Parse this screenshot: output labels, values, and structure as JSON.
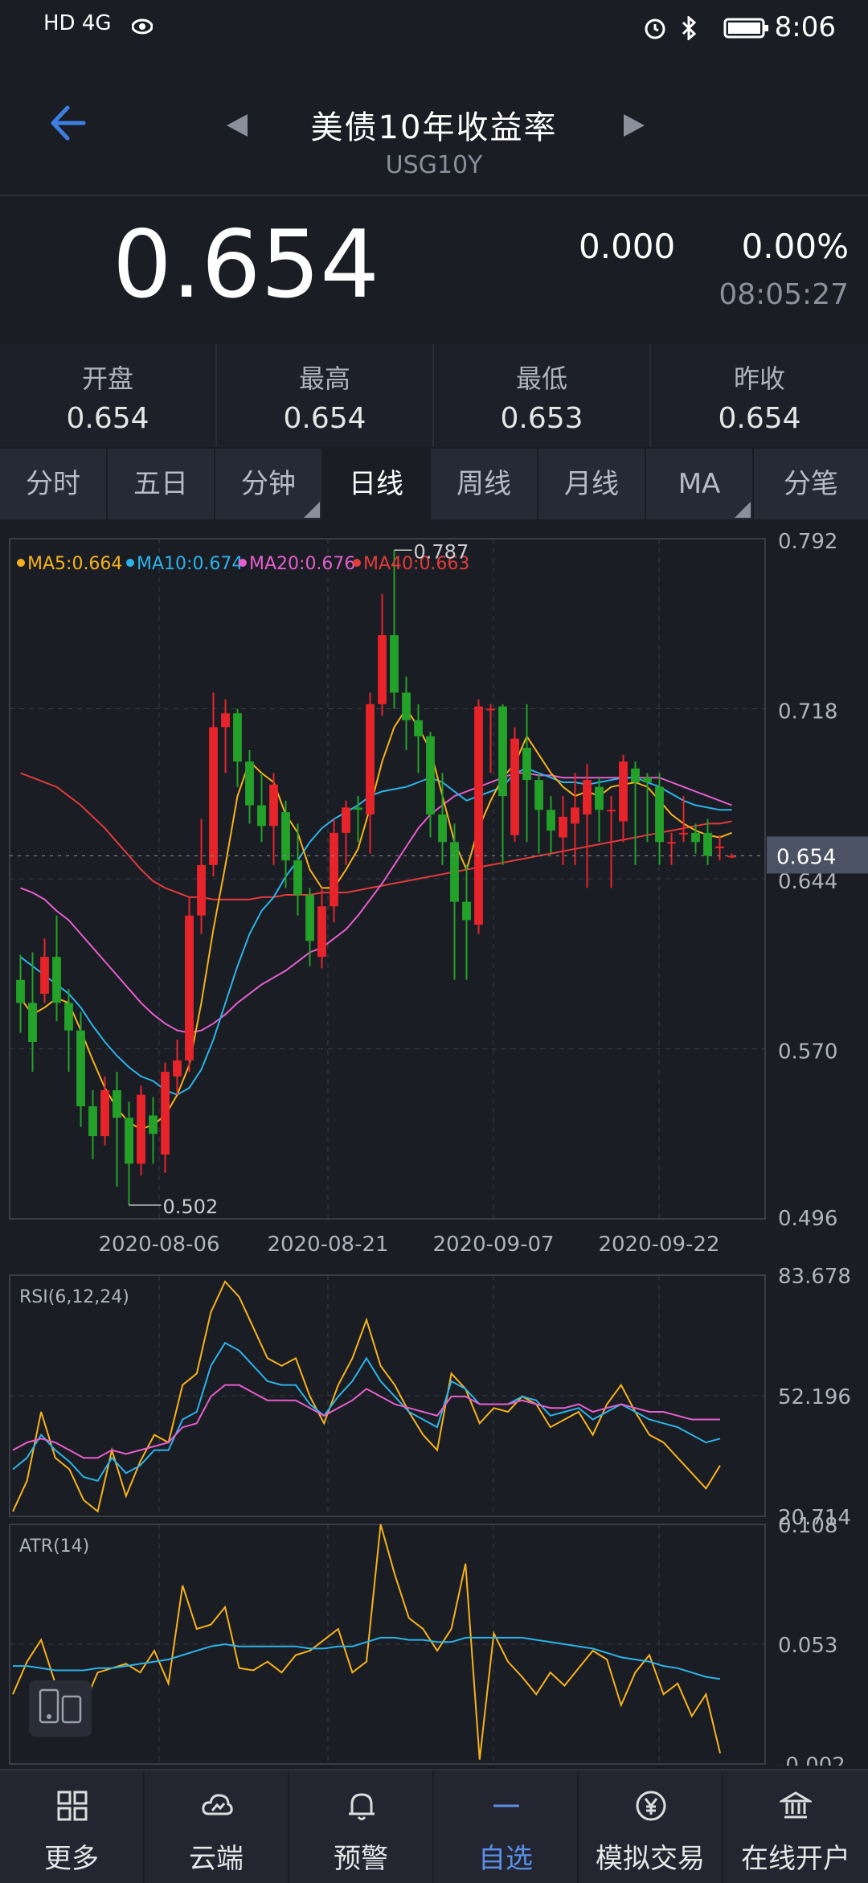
{
  "statusbar": {
    "left": "HD 4G",
    "time": "8:06"
  },
  "header": {
    "title": "美债10年收益率",
    "code": "USG10Y"
  },
  "quote": {
    "price": "0.654",
    "change": "0.000",
    "percent": "0.00%",
    "time": "08:05:27"
  },
  "stats": [
    {
      "label": "开盘",
      "value": "0.654"
    },
    {
      "label": "最高",
      "value": "0.654"
    },
    {
      "label": "最低",
      "value": "0.653"
    },
    {
      "label": "昨收",
      "value": "0.654"
    }
  ],
  "tabs": [
    "分时",
    "五日",
    "分钟",
    "日线",
    "周线",
    "月线",
    "MA",
    "分笔"
  ],
  "active_tab": "日线",
  "colors": {
    "up": "#e8242b",
    "down": "#23a129",
    "ma5": "#f6b21c",
    "ma10": "#2bb3e8",
    "ma20": "#e45fcd",
    "ma40": "#e23b3b",
    "accent": "#5b8fe6"
  },
  "chart_data": [
    {
      "type": "candlestick",
      "legend": [
        {
          "name": "MA5",
          "value": "0.664"
        },
        {
          "name": "MA10",
          "value": "0.674"
        },
        {
          "name": "MA20",
          "value": "0.676"
        },
        {
          "name": "MA40",
          "value": "0.663"
        }
      ],
      "y_ticks": [
        "0.792",
        "0.718",
        "0.644",
        "0.570",
        "0.496"
      ],
      "ylim": [
        0.496,
        0.792
      ],
      "x_ticks": [
        "2020-08-06",
        "2020-08-21",
        "2020-09-07",
        "2020-09-22"
      ],
      "current_label": "0.654",
      "current_value": 0.654,
      "max_label": "0.787",
      "min_label": "0.502",
      "candles": [
        [
          0.6,
          0.59,
          0.611,
          0.577
        ],
        [
          0.59,
          0.573,
          0.612,
          0.56
        ],
        [
          0.594,
          0.61,
          0.618,
          0.59
        ],
        [
          0.61,
          0.59,
          0.628,
          0.582
        ],
        [
          0.59,
          0.578,
          0.596,
          0.56
        ],
        [
          0.578,
          0.545,
          0.586,
          0.536
        ],
        [
          0.545,
          0.532,
          0.552,
          0.522
        ],
        [
          0.532,
          0.552,
          0.558,
          0.528
        ],
        [
          0.552,
          0.54,
          0.56,
          0.51
        ],
        [
          0.54,
          0.52,
          0.547,
          0.502
        ],
        [
          0.52,
          0.55,
          0.554,
          0.515
        ],
        [
          0.541,
          0.533,
          0.549,
          0.52
        ],
        [
          0.524,
          0.56,
          0.564,
          0.516
        ],
        [
          0.558,
          0.565,
          0.574,
          0.55
        ],
        [
          0.565,
          0.628,
          0.636,
          0.56
        ],
        [
          0.628,
          0.65,
          0.67,
          0.62
        ],
        [
          0.65,
          0.71,
          0.725,
          0.645
        ],
        [
          0.71,
          0.716,
          0.722,
          0.69
        ],
        [
          0.716,
          0.695,
          0.718,
          0.684
        ],
        [
          0.695,
          0.676,
          0.7,
          0.668
        ],
        [
          0.676,
          0.667,
          0.69,
          0.66
        ],
        [
          0.667,
          0.685,
          0.69,
          0.65
        ],
        [
          0.673,
          0.652,
          0.678,
          0.64
        ],
        [
          0.652,
          0.637,
          0.668,
          0.628
        ],
        [
          0.637,
          0.617,
          0.64,
          0.606
        ],
        [
          0.61,
          0.632,
          0.64,
          0.605
        ],
        [
          0.632,
          0.664,
          0.67,
          0.625
        ],
        [
          0.664,
          0.675,
          0.678,
          0.65
        ],
        [
          0.675,
          0.674,
          0.68,
          0.66
        ],
        [
          0.672,
          0.72,
          0.725,
          0.655
        ],
        [
          0.72,
          0.75,
          0.768,
          0.715
        ],
        [
          0.75,
          0.725,
          0.787,
          0.718
        ],
        [
          0.725,
          0.713,
          0.732,
          0.7
        ],
        [
          0.713,
          0.706,
          0.72,
          0.69
        ],
        [
          0.706,
          0.672,
          0.708,
          0.662
        ],
        [
          0.672,
          0.66,
          0.69,
          0.65
        ],
        [
          0.66,
          0.634,
          0.668,
          0.6
        ],
        [
          0.634,
          0.626,
          0.65,
          0.6
        ],
        [
          0.624,
          0.719,
          0.722,
          0.62
        ],
        [
          0.718,
          0.718,
          0.72,
          0.69
        ],
        [
          0.719,
          0.68,
          0.72,
          0.65
        ],
        [
          0.663,
          0.705,
          0.71,
          0.66
        ],
        [
          0.701,
          0.687,
          0.72,
          0.66
        ],
        [
          0.687,
          0.674,
          0.69,
          0.655
        ],
        [
          0.674,
          0.665,
          0.68,
          0.655
        ],
        [
          0.662,
          0.671,
          0.68,
          0.65
        ],
        [
          0.668,
          0.675,
          0.69,
          0.65
        ],
        [
          0.672,
          0.687,
          0.694,
          0.64
        ],
        [
          0.684,
          0.674,
          0.688,
          0.66
        ],
        [
          0.674,
          0.674,
          0.68,
          0.64
        ],
        [
          0.669,
          0.695,
          0.698,
          0.66
        ],
        [
          0.692,
          0.686,
          0.695,
          0.65
        ],
        [
          0.688,
          0.686,
          0.69,
          0.66
        ],
        [
          0.684,
          0.66,
          0.69,
          0.65
        ],
        [
          0.66,
          0.66,
          0.664,
          0.65
        ],
        [
          0.664,
          0.664,
          0.68,
          0.66
        ],
        [
          0.664,
          0.66,
          0.668,
          0.655
        ],
        [
          0.664,
          0.654,
          0.67,
          0.65
        ],
        [
          0.658,
          0.658,
          0.663,
          0.652
        ],
        [
          0.654,
          0.654,
          0.655,
          0.653
        ]
      ],
      "ma5": [
        0.592,
        0.585,
        0.588,
        0.592,
        0.59,
        0.578,
        0.565,
        0.553,
        0.544,
        0.538,
        0.535,
        0.537,
        0.541,
        0.55,
        0.563,
        0.59,
        0.622,
        0.65,
        0.68,
        0.695,
        0.69,
        0.686,
        0.672,
        0.664,
        0.648,
        0.64,
        0.64,
        0.648,
        0.657,
        0.675,
        0.695,
        0.71,
        0.718,
        0.71,
        0.7,
        0.68,
        0.66,
        0.648,
        0.666,
        0.678,
        0.688,
        0.694,
        0.706,
        0.698,
        0.69,
        0.684,
        0.68,
        0.682,
        0.68,
        0.684,
        0.685,
        0.686,
        0.684,
        0.678,
        0.672,
        0.668,
        0.665,
        0.663,
        0.662,
        0.664
      ],
      "ma10": [
        0.61,
        0.606,
        0.602,
        0.598,
        0.594,
        0.588,
        0.58,
        0.573,
        0.567,
        0.562,
        0.558,
        0.556,
        0.552,
        0.55,
        0.553,
        0.561,
        0.574,
        0.59,
        0.606,
        0.62,
        0.63,
        0.636,
        0.645,
        0.652,
        0.66,
        0.666,
        0.67,
        0.673,
        0.676,
        0.68,
        0.682,
        0.683,
        0.684,
        0.686,
        0.688,
        0.686,
        0.682,
        0.678,
        0.68,
        0.682,
        0.684,
        0.69,
        0.692,
        0.69,
        0.688,
        0.686,
        0.686,
        0.685,
        0.686,
        0.687,
        0.688,
        0.688,
        0.686,
        0.684,
        0.681,
        0.678,
        0.676,
        0.675,
        0.674,
        0.674
      ],
      "ma20": [
        0.64,
        0.638,
        0.635,
        0.63,
        0.626,
        0.62,
        0.614,
        0.608,
        0.602,
        0.596,
        0.59,
        0.585,
        0.581,
        0.578,
        0.577,
        0.578,
        0.581,
        0.585,
        0.59,
        0.594,
        0.598,
        0.601,
        0.604,
        0.608,
        0.612,
        0.614,
        0.618,
        0.622,
        0.628,
        0.635,
        0.642,
        0.65,
        0.658,
        0.666,
        0.672,
        0.676,
        0.68,
        0.682,
        0.684,
        0.686,
        0.688,
        0.69,
        0.69,
        0.689,
        0.689,
        0.688,
        0.688,
        0.688,
        0.688,
        0.688,
        0.688,
        0.688,
        0.688,
        0.688,
        0.686,
        0.684,
        0.682,
        0.68,
        0.678,
        0.676
      ],
      "ma40": [
        0.69,
        0.688,
        0.686,
        0.684,
        0.68,
        0.676,
        0.671,
        0.666,
        0.66,
        0.654,
        0.648,
        0.643,
        0.64,
        0.638,
        0.636,
        0.636,
        0.635,
        0.635,
        0.635,
        0.635,
        0.636,
        0.636,
        0.637,
        0.637,
        0.637,
        0.638,
        0.638,
        0.638,
        0.639,
        0.64,
        0.641,
        0.642,
        0.643,
        0.644,
        0.645,
        0.646,
        0.647,
        0.648,
        0.649,
        0.65,
        0.651,
        0.652,
        0.653,
        0.654,
        0.655,
        0.656,
        0.657,
        0.658,
        0.659,
        0.66,
        0.661,
        0.662,
        0.663,
        0.664,
        0.665,
        0.666,
        0.667,
        0.668,
        0.668,
        0.669
      ]
    },
    {
      "type": "line",
      "title": "RSI(6,12,24)",
      "y_ticks": [
        "83.678",
        "52.196",
        "20.714"
      ],
      "ylim": [
        20.714,
        83.678
      ],
      "series": [
        {
          "name": "RSI6",
          "color": "#f6b21c",
          "values": [
            22,
            30,
            48,
            36,
            33,
            25,
            22,
            38,
            26,
            35,
            42,
            40,
            55,
            58,
            74,
            82,
            78,
            70,
            62,
            60,
            62,
            52,
            45,
            55,
            62,
            72,
            60,
            55,
            48,
            42,
            38,
            58,
            54,
            45,
            49,
            48,
            52,
            50,
            44,
            46,
            48,
            42,
            50,
            55,
            48,
            42,
            40,
            36,
            32,
            28,
            34
          ]
        },
        {
          "name": "RSI12",
          "color": "#2bb3e8",
          "values": [
            33,
            36,
            42,
            38,
            35,
            31,
            30,
            36,
            32,
            34,
            38,
            38,
            46,
            48,
            60,
            66,
            64,
            60,
            56,
            55,
            55,
            50,
            47,
            52,
            56,
            62,
            56,
            52,
            48,
            46,
            44,
            56,
            54,
            50,
            50,
            50,
            52,
            51,
            47,
            48,
            49,
            46,
            48,
            50,
            48,
            46,
            45,
            44,
            42,
            40,
            41
          ]
        },
        {
          "name": "RSI24",
          "color": "#e45fcd",
          "values": [
            38,
            40,
            41,
            40,
            38,
            36,
            36,
            38,
            37,
            38,
            39,
            40,
            44,
            45,
            52,
            55,
            55,
            53,
            51,
            51,
            51,
            49,
            47,
            49,
            51,
            54,
            52,
            50,
            49,
            48,
            47,
            52,
            52,
            50,
            50,
            50,
            51,
            50,
            49,
            49,
            50,
            48,
            49,
            50,
            49,
            48,
            48,
            47,
            46,
            46,
            46
          ]
        }
      ]
    },
    {
      "type": "line",
      "title": "ATR(14)",
      "y_ticks": [
        "0.108",
        "0.053",
        "-0.002"
      ],
      "ylim": [
        -0.002,
        0.108
      ],
      "series": [
        {
          "name": "ATR",
          "color": "#f6b21c",
          "values": [
            0.03,
            0.045,
            0.055,
            0.035,
            0.03,
            0.025,
            0.04,
            0.042,
            0.044,
            0.04,
            0.05,
            0.035,
            0.08,
            0.06,
            0.062,
            0.07,
            0.042,
            0.041,
            0.045,
            0.04,
            0.048,
            0.05,
            0.055,
            0.06,
            0.04,
            0.045,
            0.108,
            0.085,
            0.065,
            0.06,
            0.05,
            0.06,
            0.09,
            0.0,
            0.058,
            0.045,
            0.038,
            0.03,
            0.04,
            0.034,
            0.042,
            0.05,
            0.046,
            0.025,
            0.04,
            0.048,
            0.03,
            0.035,
            0.02,
            0.03,
            0.003
          ]
        },
        {
          "name": "ATR-MA",
          "color": "#2bb3e8",
          "values": [
            0.043,
            0.043,
            0.042,
            0.041,
            0.041,
            0.041,
            0.042,
            0.042,
            0.043,
            0.044,
            0.045,
            0.046,
            0.048,
            0.05,
            0.052,
            0.053,
            0.052,
            0.052,
            0.052,
            0.052,
            0.052,
            0.051,
            0.051,
            0.052,
            0.052,
            0.054,
            0.056,
            0.056,
            0.055,
            0.055,
            0.054,
            0.054,
            0.056,
            0.056,
            0.056,
            0.056,
            0.056,
            0.055,
            0.054,
            0.053,
            0.052,
            0.051,
            0.049,
            0.047,
            0.046,
            0.045,
            0.043,
            0.042,
            0.04,
            0.038,
            0.037
          ]
        }
      ]
    }
  ],
  "bottom_nav": [
    {
      "label": "更多",
      "icon": "grid-icon"
    },
    {
      "label": "云端",
      "icon": "cloud-icon"
    },
    {
      "label": "预警",
      "icon": "bell-icon"
    },
    {
      "label": "自选",
      "icon": "minus-icon"
    },
    {
      "label": "模拟交易",
      "icon": "yen-icon"
    },
    {
      "label": "在线开户",
      "icon": "bank-icon"
    }
  ]
}
